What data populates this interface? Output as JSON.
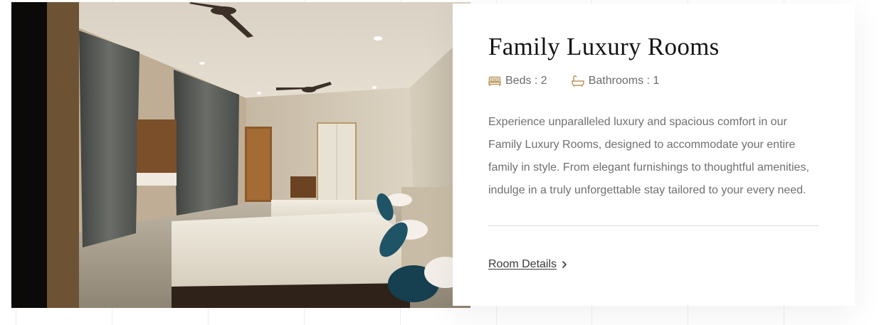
{
  "room": {
    "title": "Family Luxury Rooms",
    "beds_label": "Beds : 2",
    "bathrooms_label": "Bathrooms : 1",
    "description": "Experience unparalleled luxury and spacious comfort in our Family Luxury Rooms, designed to accommodate your entire family in style. From elegant furnishings to thoughtful amenities, indulge in a truly unforgettable stay tailored to your every need.",
    "details_link": "Room Details"
  },
  "icons": {
    "beds": "bed-icon",
    "bathrooms": "bathtub-icon",
    "details": "chevron-right-icon",
    "accent_color": "#b8975a"
  }
}
